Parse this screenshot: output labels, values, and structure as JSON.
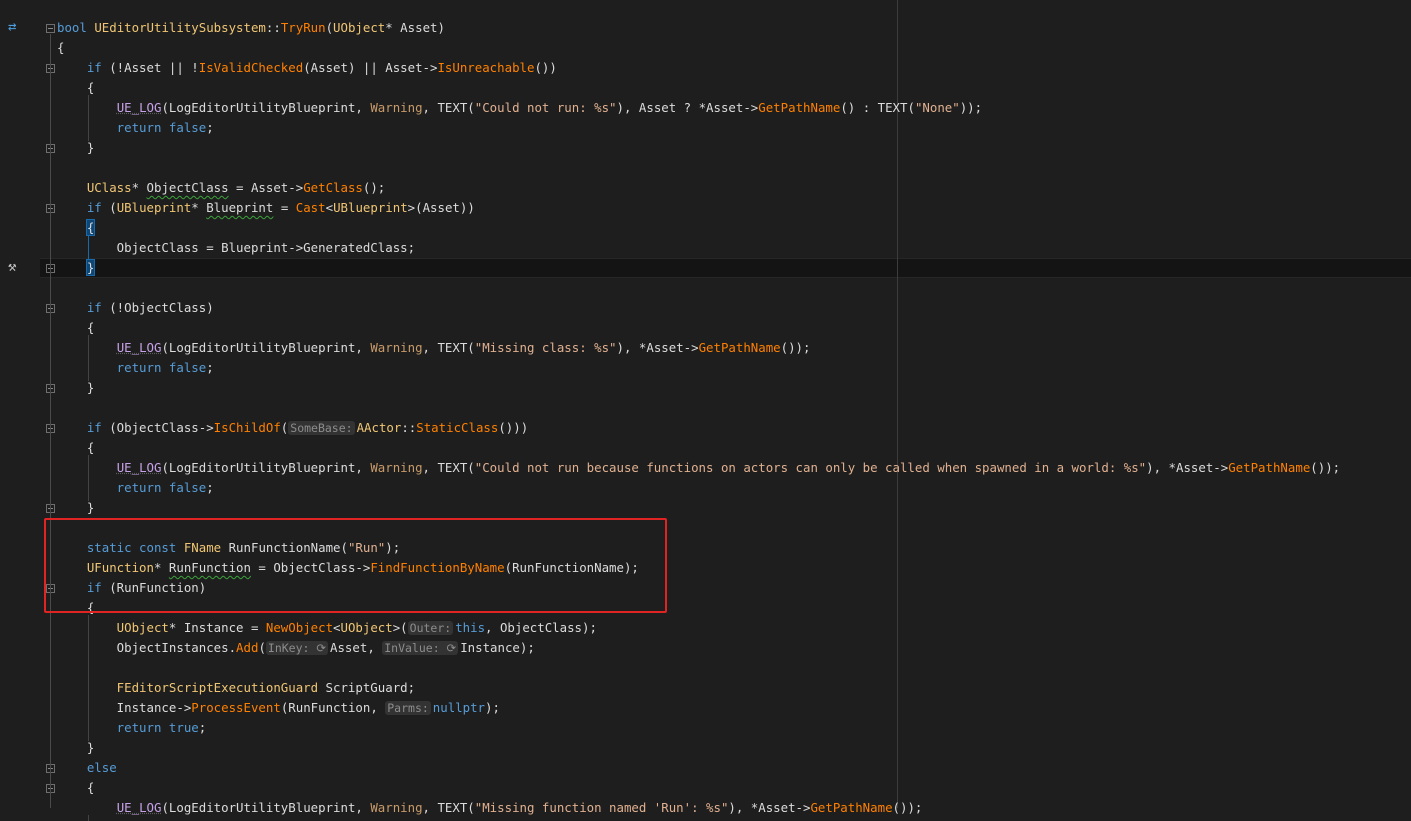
{
  "editor": {
    "gutter_icons": [
      {
        "name": "sync-navigate-icon",
        "glyph": "⇄",
        "line": 0
      },
      {
        "name": "hammer-build-icon",
        "glyph": "⚒",
        "line": 12
      }
    ],
    "highlight_box_color": "#e02323",
    "lines": [
      [
        {
          "t": "bool ",
          "c": "#569cd6"
        },
        {
          "t": "UEditorUtilitySubsystem",
          "c": "#f0c674"
        },
        {
          "t": "::",
          "c": "#dcdcdc"
        },
        {
          "t": "TryRun",
          "c": "#ff8000"
        },
        {
          "t": "(",
          "c": "#dcdcdc"
        },
        {
          "t": "UObject",
          "c": "#f0c674"
        },
        {
          "t": "* Asset)",
          "c": "#dcdcdc"
        }
      ],
      [
        {
          "t": "{",
          "c": "#dcdcdc"
        }
      ],
      [
        {
          "t": "    if ",
          "c": "#569cd6"
        },
        {
          "t": "(!Asset || !",
          "c": "#dcdcdc"
        },
        {
          "t": "IsValidChecked",
          "c": "#ff8000"
        },
        {
          "t": "(Asset) || Asset->",
          "c": "#dcdcdc"
        },
        {
          "t": "IsUnreachable",
          "c": "#ff8000"
        },
        {
          "t": "())",
          "c": "#dcdcdc"
        }
      ],
      [
        {
          "t": "    {",
          "c": "#dcdcdc"
        }
      ],
      [
        {
          "t": "        ",
          "c": "#dcdcdc"
        },
        {
          "t": "UE_LOG",
          "c": "#c8a2e8",
          "u": true
        },
        {
          "t": "(LogEditorUtilityBlueprint, ",
          "c": "#dcdcdc"
        },
        {
          "t": "Warning",
          "c": "#c89b6a"
        },
        {
          "t": ", TEXT(",
          "c": "#dcdcdc"
        },
        {
          "t": "\"Could not run: %s\"",
          "c": "#e0b090"
        },
        {
          "t": "), Asset ? *Asset->",
          "c": "#dcdcdc"
        },
        {
          "t": "GetPathName",
          "c": "#ff8000"
        },
        {
          "t": "() : TEXT(",
          "c": "#dcdcdc"
        },
        {
          "t": "\"None\"",
          "c": "#e0b090"
        },
        {
          "t": "));",
          "c": "#dcdcdc"
        }
      ],
      [
        {
          "t": "        return false",
          "c": "#569cd6"
        },
        {
          "t": ";",
          "c": "#dcdcdc"
        }
      ],
      [
        {
          "t": "    }",
          "c": "#dcdcdc"
        }
      ],
      [],
      [
        {
          "t": "    UClass",
          "c": "#f0c674"
        },
        {
          "t": "* ",
          "c": "#dcdcdc"
        },
        {
          "t": "ObjectClass",
          "c": "#dcdcdc",
          "sq": true
        },
        {
          "t": " = Asset->",
          "c": "#dcdcdc"
        },
        {
          "t": "GetClass",
          "c": "#ff8000"
        },
        {
          "t": "();",
          "c": "#dcdcdc"
        }
      ],
      [
        {
          "t": "    if ",
          "c": "#569cd6"
        },
        {
          "t": "(",
          "c": "#dcdcdc"
        },
        {
          "t": "UBlueprint",
          "c": "#f0c674"
        },
        {
          "t": "* ",
          "c": "#dcdcdc"
        },
        {
          "t": "Blueprint",
          "c": "#dcdcdc",
          "sq": true
        },
        {
          "t": " = ",
          "c": "#dcdcdc"
        },
        {
          "t": "Cast",
          "c": "#ff8000"
        },
        {
          "t": "<",
          "c": "#dcdcdc"
        },
        {
          "t": "UBlueprint",
          "c": "#f0c674"
        },
        {
          "t": ">(Asset))",
          "c": "#dcdcdc"
        }
      ],
      [
        {
          "t": "    ",
          "c": "#dcdcdc"
        },
        {
          "t": "{",
          "c": "#dcdcdc",
          "hl": true
        }
      ],
      [
        {
          "t": "        ObjectClass = Blueprint->GeneratedClass;",
          "c": "#dcdcdc"
        }
      ],
      [
        {
          "t": "    ",
          "c": "#dcdcdc"
        },
        {
          "t": "}",
          "c": "#dcdcdc",
          "hl": true
        }
      ],
      [],
      [
        {
          "t": "    if ",
          "c": "#569cd6"
        },
        {
          "t": "(!ObjectClass)",
          "c": "#dcdcdc"
        }
      ],
      [
        {
          "t": "    {",
          "c": "#dcdcdc"
        }
      ],
      [
        {
          "t": "        ",
          "c": "#dcdcdc"
        },
        {
          "t": "UE_LOG",
          "c": "#c8a2e8",
          "u": true
        },
        {
          "t": "(LogEditorUtilityBlueprint, ",
          "c": "#dcdcdc"
        },
        {
          "t": "Warning",
          "c": "#c89b6a"
        },
        {
          "t": ", TEXT(",
          "c": "#dcdcdc"
        },
        {
          "t": "\"Missing class: %s\"",
          "c": "#e0b090"
        },
        {
          "t": "), *Asset->",
          "c": "#dcdcdc"
        },
        {
          "t": "GetPathName",
          "c": "#ff8000"
        },
        {
          "t": "());",
          "c": "#dcdcdc"
        }
      ],
      [
        {
          "t": "        return false",
          "c": "#569cd6"
        },
        {
          "t": ";",
          "c": "#dcdcdc"
        }
      ],
      [
        {
          "t": "    }",
          "c": "#dcdcdc"
        }
      ],
      [],
      [
        {
          "t": "    if ",
          "c": "#569cd6"
        },
        {
          "t": "(ObjectClass->",
          "c": "#dcdcdc"
        },
        {
          "t": "IsChildOf",
          "c": "#ff8000"
        },
        {
          "t": "(",
          "c": "#dcdcdc"
        },
        {
          "t": "SomeBase:",
          "hint": true
        },
        {
          "t": "AActor",
          "c": "#f0c674"
        },
        {
          "t": "::",
          "c": "#dcdcdc"
        },
        {
          "t": "StaticClass",
          "c": "#ff8000"
        },
        {
          "t": "()))",
          "c": "#dcdcdc"
        }
      ],
      [
        {
          "t": "    {",
          "c": "#dcdcdc"
        }
      ],
      [
        {
          "t": "        ",
          "c": "#dcdcdc"
        },
        {
          "t": "UE_LOG",
          "c": "#c8a2e8",
          "u": true
        },
        {
          "t": "(LogEditorUtilityBlueprint, ",
          "c": "#dcdcdc"
        },
        {
          "t": "Warning",
          "c": "#c89b6a"
        },
        {
          "t": ", TEXT(",
          "c": "#dcdcdc"
        },
        {
          "t": "\"Could not run because functions on actors can only be called when spawned in a world: %s\"",
          "c": "#e0b090"
        },
        {
          "t": "), *Asset->",
          "c": "#dcdcdc"
        },
        {
          "t": "GetPathName",
          "c": "#ff8000"
        },
        {
          "t": "());",
          "c": "#dcdcdc"
        }
      ],
      [
        {
          "t": "        return false",
          "c": "#569cd6"
        },
        {
          "t": ";",
          "c": "#dcdcdc"
        }
      ],
      [
        {
          "t": "    }",
          "c": "#dcdcdc"
        }
      ],
      [],
      [
        {
          "t": "    static const ",
          "c": "#569cd6"
        },
        {
          "t": "FName",
          "c": "#f0c674"
        },
        {
          "t": " RunFunctionName(",
          "c": "#dcdcdc"
        },
        {
          "t": "\"Run\"",
          "c": "#e0b090"
        },
        {
          "t": ");",
          "c": "#dcdcdc"
        }
      ],
      [
        {
          "t": "    UFunction",
          "c": "#f0c674"
        },
        {
          "t": "* ",
          "c": "#dcdcdc"
        },
        {
          "t": "RunFunction",
          "c": "#dcdcdc",
          "sq": true
        },
        {
          "t": " = ObjectClass->",
          "c": "#dcdcdc"
        },
        {
          "t": "FindFunctionByName",
          "c": "#ff8000"
        },
        {
          "t": "(RunFunctionName);",
          "c": "#dcdcdc"
        }
      ],
      [
        {
          "t": "    if ",
          "c": "#569cd6"
        },
        {
          "t": "(RunFunction)",
          "c": "#dcdcdc"
        }
      ],
      [
        {
          "t": "    {",
          "c": "#dcdcdc"
        }
      ],
      [
        {
          "t": "        UObject",
          "c": "#f0c674"
        },
        {
          "t": "* Instance = ",
          "c": "#dcdcdc"
        },
        {
          "t": "NewObject",
          "c": "#ff8000"
        },
        {
          "t": "<",
          "c": "#dcdcdc"
        },
        {
          "t": "UObject",
          "c": "#f0c674"
        },
        {
          "t": ">(",
          "c": "#dcdcdc"
        },
        {
          "t": "Outer:",
          "hint": true
        },
        {
          "t": "this",
          "c": "#569cd6"
        },
        {
          "t": ", ObjectClass);",
          "c": "#dcdcdc"
        }
      ],
      [
        {
          "t": "        ObjectInstances.",
          "c": "#dcdcdc"
        },
        {
          "t": "Add",
          "c": "#ff8000"
        },
        {
          "t": "(",
          "c": "#dcdcdc"
        },
        {
          "t": "InKey: ⟳",
          "hint": true
        },
        {
          "t": "Asset, ",
          "c": "#dcdcdc"
        },
        {
          "t": "InValue: ⟳",
          "hint": true
        },
        {
          "t": "Instance);",
          "c": "#dcdcdc"
        }
      ],
      [],
      [
        {
          "t": "        FEditorScriptExecutionGuard",
          "c": "#f0c674"
        },
        {
          "t": " ScriptGuard;",
          "c": "#dcdcdc"
        }
      ],
      [
        {
          "t": "        Instance->",
          "c": "#dcdcdc"
        },
        {
          "t": "ProcessEvent",
          "c": "#ff8000"
        },
        {
          "t": "(RunFunction, ",
          "c": "#dcdcdc"
        },
        {
          "t": "Parms:",
          "hint": true
        },
        {
          "t": "nullptr",
          "c": "#569cd6"
        },
        {
          "t": ");",
          "c": "#dcdcdc"
        }
      ],
      [
        {
          "t": "        return true",
          "c": "#569cd6"
        },
        {
          "t": ";",
          "c": "#dcdcdc"
        }
      ],
      [
        {
          "t": "    }",
          "c": "#dcdcdc"
        }
      ],
      [
        {
          "t": "    else",
          "c": "#569cd6"
        }
      ],
      [
        {
          "t": "    {",
          "c": "#dcdcdc"
        }
      ],
      [
        {
          "t": "        ",
          "c": "#dcdcdc"
        },
        {
          "t": "UE_LOG",
          "c": "#c8a2e8",
          "u": true
        },
        {
          "t": "(LogEditorUtilityBlueprint, ",
          "c": "#dcdcdc"
        },
        {
          "t": "Warning",
          "c": "#c89b6a"
        },
        {
          "t": ", TEXT(",
          "c": "#dcdcdc"
        },
        {
          "t": "\"Missing function named 'Run': %s\"",
          "c": "#e0b090"
        },
        {
          "t": "), *Asset->",
          "c": "#dcdcdc"
        },
        {
          "t": "GetPathName",
          "c": "#ff8000"
        },
        {
          "t": "());",
          "c": "#dcdcdc"
        }
      ]
    ]
  }
}
